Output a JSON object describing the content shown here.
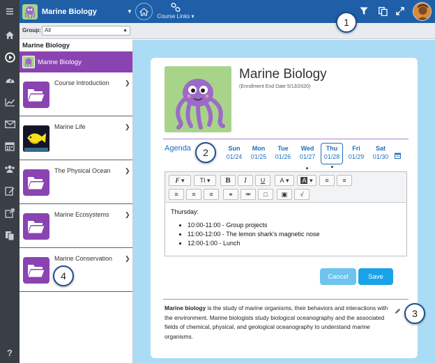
{
  "topbar": {
    "course_title": "Marine Biology",
    "links_label": "Course Links",
    "icons": [
      "filter-icon",
      "copy-icon",
      "expand-icon"
    ]
  },
  "group": {
    "label": "Group:",
    "selected": "All"
  },
  "sidebar": {
    "header": "Marine Biology",
    "active_label": "Marine Biology",
    "items": [
      {
        "label": "Course Introduction",
        "thumb": "folder"
      },
      {
        "label": "Marine Life",
        "thumb": "fish"
      },
      {
        "label": "The Physical Ocean",
        "thumb": "folder"
      },
      {
        "label": "Marine Ecosystems",
        "thumb": "folder"
      },
      {
        "label": "Marine Conservation",
        "thumb": "folder"
      }
    ]
  },
  "course": {
    "title": "Marine Biology",
    "enrollment": "(Enrollment End Date 5/13/2020)"
  },
  "agenda": {
    "label": "Agenda",
    "days": [
      {
        "name": "Sun",
        "date": "01/24"
      },
      {
        "name": "Mon",
        "date": "01/25"
      },
      {
        "name": "Tue",
        "date": "01/26"
      },
      {
        "name": "Wed",
        "date": "01/27"
      },
      {
        "name": "Thu",
        "date": "01/28"
      },
      {
        "name": "Fri",
        "date": "01/29"
      },
      {
        "name": "Sat",
        "date": "01/30"
      }
    ],
    "selected_day": "Thu"
  },
  "editor": {
    "heading": "Thursday:",
    "items": [
      "10:00-11:00 - Group projects",
      "11:00-12:00 - The lemon shark's magnetic nose",
      "12:00-1:00 - Lunch"
    ],
    "buttons": {
      "cancel": "Cancel",
      "save": "Save"
    }
  },
  "description": {
    "bold": "Marine biology",
    "text": " is the study of marine organisms, their behaviors and interactions with the environment. Marine biologists study biological oceanography and the associated fields of chemical, physical, and geological oceanography to understand marine organisms."
  },
  "callouts": [
    "1",
    "2",
    "3",
    "4"
  ],
  "colors": {
    "rail": "#3a3f45",
    "topbar": "#1f5fa8",
    "accent_purple": "#8a44b2",
    "content_bg": "#aadcf5",
    "link_blue": "#1f6fbf",
    "button_blue": "#1aa3e8"
  }
}
